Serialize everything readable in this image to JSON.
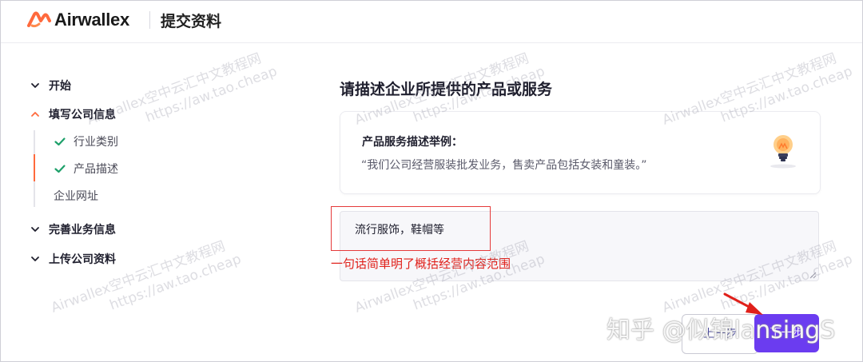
{
  "header": {
    "brand": "Airwallex",
    "page_title": "提交资料"
  },
  "sidebar": {
    "steps": [
      {
        "label": "开始",
        "state": "collapsed"
      },
      {
        "label": "填写公司信息",
        "state": "expanded"
      },
      {
        "label": "完善业务信息",
        "state": "collapsed"
      },
      {
        "label": "上传公司资料",
        "state": "collapsed"
      }
    ],
    "substeps": [
      {
        "label": "行业类别",
        "done": true
      },
      {
        "label": "产品描述",
        "done": true,
        "active": true
      },
      {
        "label": "企业网址",
        "done": false
      }
    ]
  },
  "main": {
    "title": "请描述企业所提供的产品或服务",
    "example": {
      "heading": "产品服务描述举例：",
      "text": "“我们公司经营服装批发业务，售卖产品包括女装和童装。”"
    },
    "description_value": "流行服饰，鞋帽等"
  },
  "annotation": {
    "text": "一句话简单明了概括经营内容范围",
    "color": "#e0201a"
  },
  "buttons": {
    "prev": "上一步",
    "next": "下一步"
  },
  "watermark": {
    "line1": "Airwallex空中云汇中文教程网",
    "line2": "https://aw.tao.cheap"
  },
  "zhihu_watermark": "知乎 @似锦lansingS",
  "colors": {
    "accent": "#6b3cf0",
    "brand_orange": "#ff6a3d",
    "check_green": "#1ea06a"
  }
}
